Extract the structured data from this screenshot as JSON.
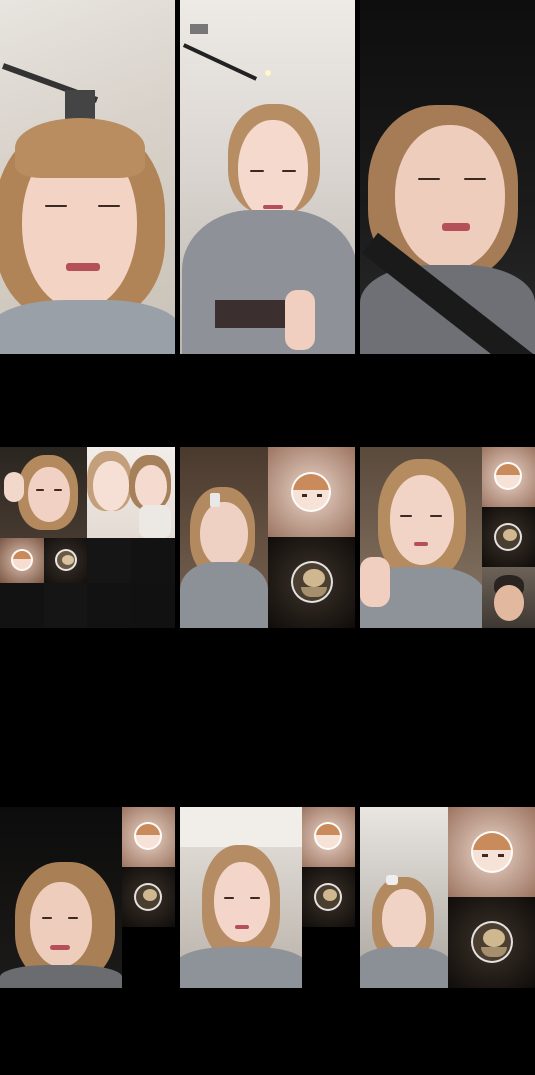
{
  "grid": {
    "cells": [
      {
        "id": "cell-1",
        "kind": "single",
        "participant": "host"
      },
      {
        "id": "cell-2",
        "kind": "single",
        "participant": "host"
      },
      {
        "id": "cell-3",
        "kind": "single",
        "participant": "host"
      },
      {
        "id": "cell-4",
        "kind": "multi-guest",
        "participant": "host"
      },
      {
        "id": "cell-5",
        "kind": "multi-guest",
        "participant": "host"
      },
      {
        "id": "cell-6",
        "kind": "multi-guest",
        "participant": "host"
      },
      {
        "id": "cell-7",
        "kind": "multi-guest",
        "participant": "host"
      },
      {
        "id": "cell-8",
        "kind": "multi-guest",
        "participant": "host"
      },
      {
        "id": "cell-9",
        "kind": "multi-guest",
        "participant": "host"
      }
    ]
  },
  "colors": {
    "background": "#000000",
    "hair": "#b88b5e",
    "skin": "#f1d2c2",
    "shirt": "#8d9096",
    "avatar_bg": "#c39f8a",
    "octopus_bg": "#2b2520"
  },
  "icons": {
    "anime_avatar": "anime-girl-avatar-icon",
    "octopus_avatar": "octopus-avatar-icon"
  }
}
